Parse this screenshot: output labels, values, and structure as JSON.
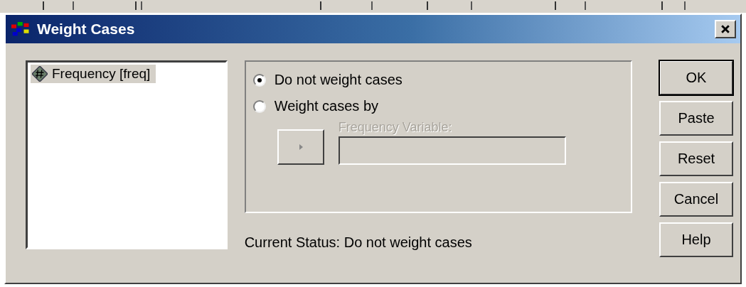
{
  "window": {
    "title": "Weight Cases"
  },
  "variables": [
    {
      "label": "Frequency [freq]",
      "selected": true
    }
  ],
  "options": [
    {
      "label": "Do not weight cases",
      "selected": true
    },
    {
      "label": "Weight cases by",
      "selected": false
    }
  ],
  "frequency_variable": {
    "label": "Frequency Variable:",
    "disabled": true
  },
  "current_status": "Current Status:  Do not weight cases",
  "buttons": [
    {
      "label": "OK",
      "default": true
    },
    {
      "label": "Paste",
      "default": false
    },
    {
      "label": "Reset",
      "default": false
    },
    {
      "label": "Cancel",
      "default": false
    },
    {
      "label": "Help",
      "default": false
    }
  ]
}
